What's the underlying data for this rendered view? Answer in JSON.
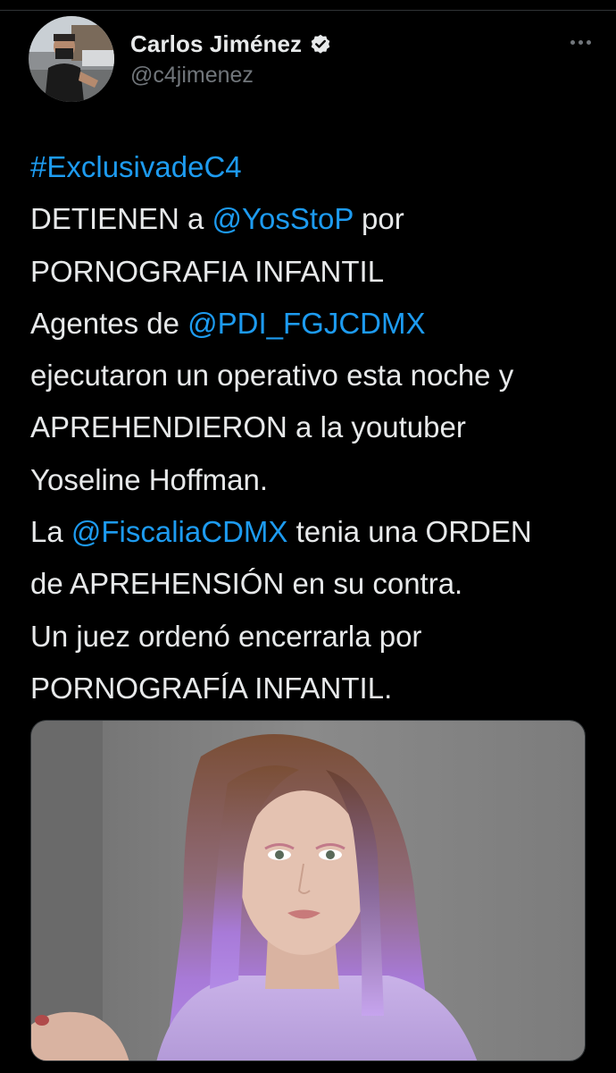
{
  "author": {
    "display_name": "Carlos Jiménez",
    "handle": "@c4jimenez",
    "verified": true,
    "avatar_icon": "user-avatar-photo",
    "verified_icon": "verified-badge-icon"
  },
  "tweet": {
    "line1": {
      "hashtag": "#ExclusivadeC4"
    },
    "line2": {
      "pre": "DETIENEN a ",
      "mention": "@YosStoP",
      "post": " por"
    },
    "line3": {
      "text": "PORNOGRAFIA INFANTIL"
    },
    "line4": {
      "pre": "Agentes de ",
      "mention": "@PDI_FGJCDMX"
    },
    "line5": {
      "text": "ejecutaron un operativo esta noche y"
    },
    "line6": {
      "text": "APREHENDIERON a la youtuber"
    },
    "line7": {
      "text": "Yoseline Hoffman."
    },
    "line8": {
      "pre": "La ",
      "mention": "@FiscaliaCDMX",
      "post": " tenia una ORDEN"
    },
    "line9": {
      "text": "de APREHENSIÓN en su contra."
    },
    "line10": {
      "text": "Un juez ordenó encerrarla por"
    },
    "line11": {
      "text": "PORNOGRAFÍA INFANTIL."
    }
  },
  "media": {
    "description_icon": "attached-photo"
  },
  "colors": {
    "background": "#000000",
    "text": "#e7e9ea",
    "secondary": "#71767b",
    "link": "#1d9bf0",
    "verified": "#e7e9ea"
  },
  "icons": {
    "more": "more-options-icon"
  }
}
